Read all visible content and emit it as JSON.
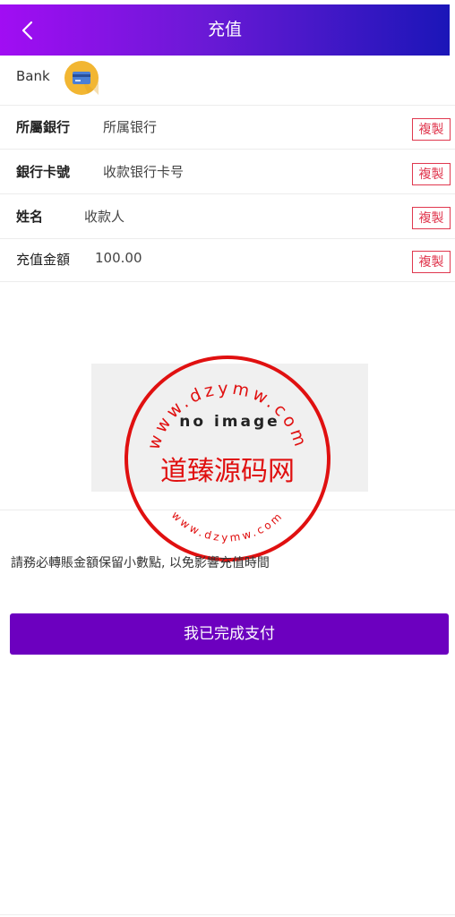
{
  "header": {
    "title": "充值",
    "back_icon": "chevron-left-icon",
    "gradient_colors": [
      "#a10df3",
      "#1b16b8"
    ]
  },
  "bank": {
    "label": "Bank",
    "icon": "credit-card-icon"
  },
  "rows": [
    {
      "label": "所屬銀行",
      "value": "所属银行",
      "copy_label": "複製"
    },
    {
      "label": "銀行卡號",
      "value": "收款银行卡号",
      "copy_label": "複製"
    },
    {
      "label": "姓名",
      "value": "收款人",
      "copy_label": "複製"
    },
    {
      "label": "充值金額",
      "value": "100.00",
      "copy_label": "複製"
    }
  ],
  "qr": {
    "placeholder_text": "no image"
  },
  "watermark": {
    "main_text": "道臻源码网",
    "ring_top_text": "www.dzymw.com",
    "ring_bottom_text": "www.dzymw.com",
    "color": "#e01010"
  },
  "notice": "請務必轉賬金額保留小數點, 以免影響充值時間",
  "submit_label": "我已完成支付",
  "colors": {
    "accent": "#6c00bf",
    "copy_button": "#e0384f"
  }
}
